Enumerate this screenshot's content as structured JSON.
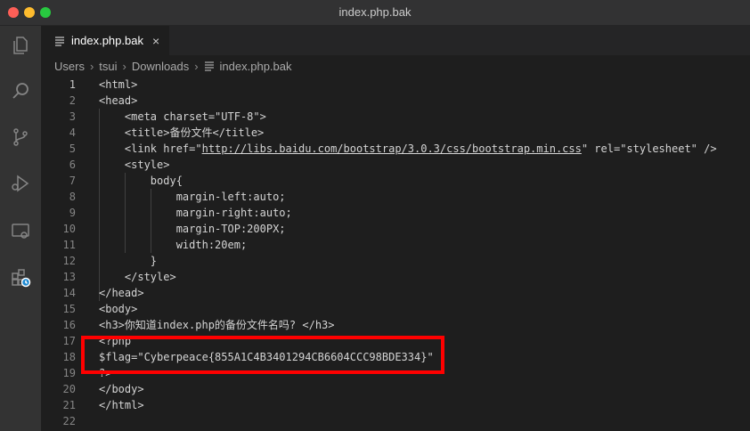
{
  "window": {
    "title": "index.php.bak"
  },
  "tab": {
    "label": "index.php.bak",
    "close": "×"
  },
  "breadcrumb": {
    "items": [
      "Users",
      "tsui",
      "Downloads",
      "index.php.bak"
    ],
    "separator": "›"
  },
  "activity_bar": {
    "icons": [
      "files-icon",
      "search-icon",
      "source-control-icon",
      "run-debug-icon",
      "remote-explorer-icon",
      "extensions-icon"
    ]
  },
  "editor": {
    "current_line": 1,
    "lines": [
      {
        "n": "1",
        "text": "<html>"
      },
      {
        "n": "2",
        "text": "<head>"
      },
      {
        "n": "3",
        "text": "    <meta charset=\"UTF-8\">"
      },
      {
        "n": "4",
        "text": "    <title>备份文件</title>"
      },
      {
        "n": "5",
        "pre": "    <link href=\"",
        "link": "http://libs.baidu.com/bootstrap/3.0.3/css/bootstrap.min.css",
        "post": "\" rel=\"stylesheet\" />"
      },
      {
        "n": "6",
        "text": "    <style>"
      },
      {
        "n": "7",
        "text": "        body{"
      },
      {
        "n": "8",
        "text": "            margin-left:auto;"
      },
      {
        "n": "9",
        "text": "            margin-right:auto;"
      },
      {
        "n": "10",
        "text": "            margin-TOP:200PX;"
      },
      {
        "n": "11",
        "text": "            width:20em;"
      },
      {
        "n": "12",
        "text": "        }"
      },
      {
        "n": "13",
        "text": "    </style>"
      },
      {
        "n": "14",
        "text": "</head>"
      },
      {
        "n": "15",
        "text": "<body>"
      },
      {
        "n": "16",
        "text": "<h3>你知道index.php的备份文件名吗? </h3>"
      },
      {
        "n": "17",
        "text": "<?php"
      },
      {
        "n": "18",
        "text": "$flag=\"Cyberpeace{855A1C4B3401294CB6604CCC98BDE334}\""
      },
      {
        "n": "19",
        "text": "?>"
      },
      {
        "n": "20",
        "text": "</body>"
      },
      {
        "n": "21",
        "text": "</html>"
      },
      {
        "n": "22",
        "text": ""
      }
    ]
  },
  "colors": {
    "editor_bg": "#1e1e1e",
    "highlight_box": "#ff0000",
    "activity_bg": "#333333"
  }
}
